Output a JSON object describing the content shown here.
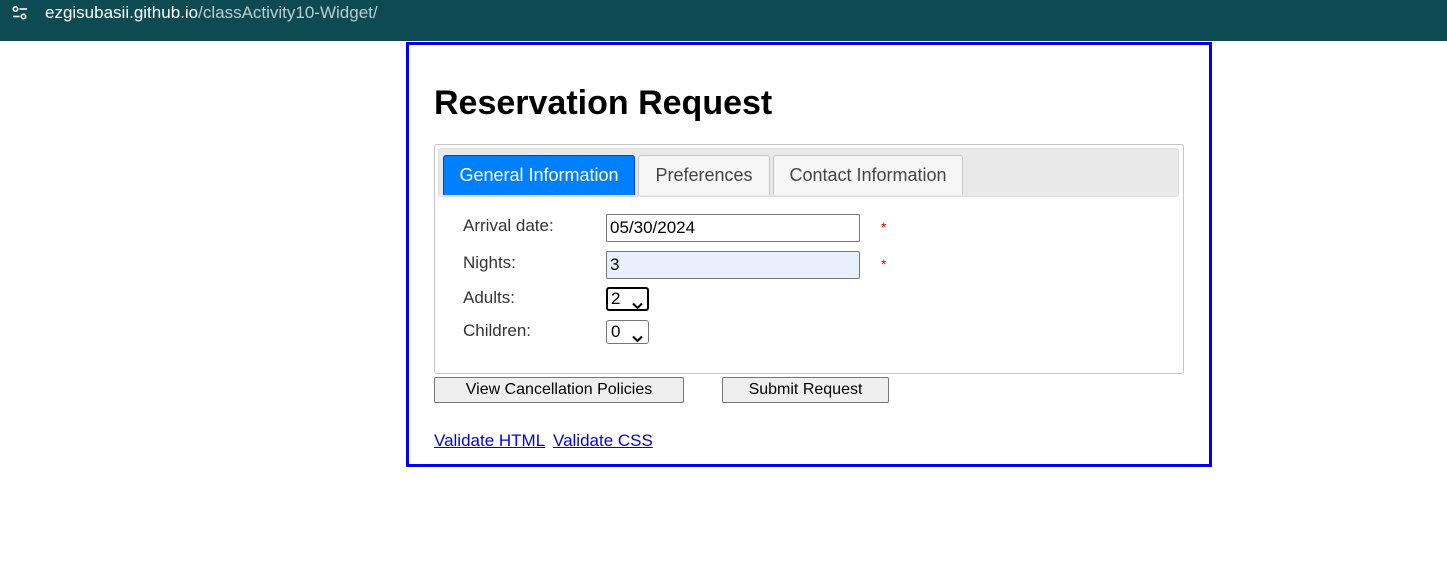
{
  "browser": {
    "url_host": "ezgisubasii.github.io",
    "url_path": "/classActivity10-Widget/",
    "site_settings_icon": "tune-icon"
  },
  "page": {
    "title": "Reservation Request",
    "border_color": "#0000ee"
  },
  "tabs": [
    {
      "label": "General Information",
      "active": true
    },
    {
      "label": "Preferences",
      "active": false
    },
    {
      "label": "Contact Information",
      "active": false
    }
  ],
  "form": {
    "arrival_date": {
      "label": "Arrival date:",
      "value": "05/30/2024",
      "required_mark": "*"
    },
    "nights": {
      "label": "Nights:",
      "value": "3",
      "required_mark": "*"
    },
    "adults": {
      "label": "Adults:",
      "value": "2"
    },
    "children": {
      "label": "Children:",
      "value": "0"
    }
  },
  "buttons": {
    "cancellation": "View Cancellation Policies",
    "submit": "Submit Request"
  },
  "links": {
    "validate_html": "Validate HTML",
    "validate_css": "Validate CSS"
  },
  "colors": {
    "active_tab": "#007fff",
    "required": "#e00000",
    "address_bar": "#0e4a52"
  }
}
